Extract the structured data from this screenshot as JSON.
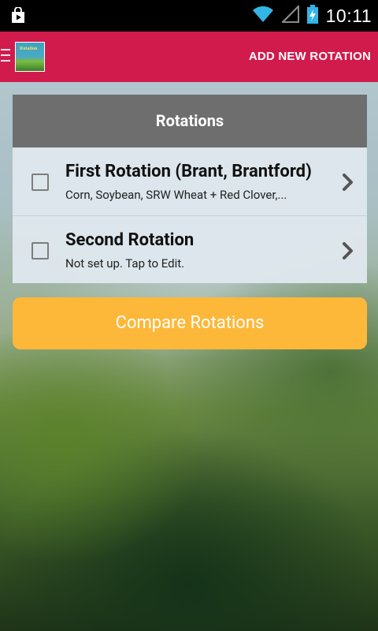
{
  "status_bar": {
    "time": "10:11",
    "icons": [
      "play-store-icon",
      "wifi-icon",
      "signal-icon",
      "battery-charging-icon"
    ]
  },
  "action_bar": {
    "logo_text": "Rotation",
    "add_button_label": "ADD NEW ROTATION"
  },
  "rotations": {
    "header": "Rotations",
    "items": [
      {
        "title": "First Rotation (Brant, Brantford)",
        "subtitle": "Corn, Soybean, SRW Wheat + Red Clover,...",
        "checked": false
      },
      {
        "title": "Second Rotation",
        "subtitle": "Not set up. Tap to Edit.",
        "checked": false
      }
    ]
  },
  "compare_button_label": "Compare Rotations",
  "colors": {
    "action_bar": "#d21b4d",
    "status_icons": "#33b5e5",
    "compare_button": "#fdb83a",
    "card_header": "#6e6e6e"
  }
}
